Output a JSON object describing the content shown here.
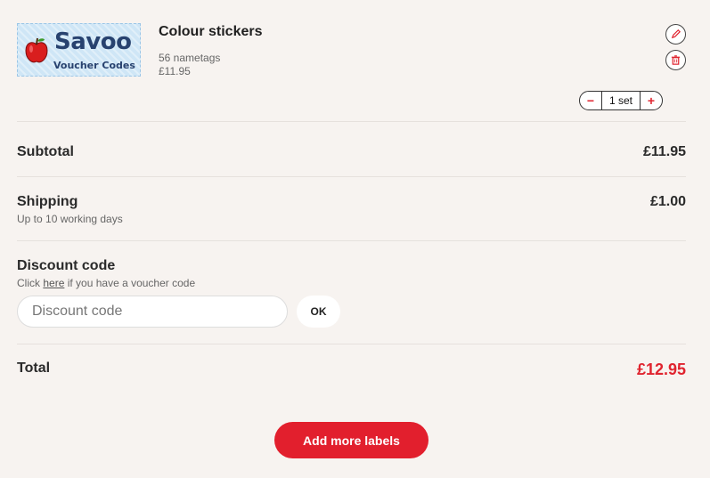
{
  "item": {
    "logo_main": "Savoo",
    "logo_sub": "Voucher Codes",
    "title": "Colour stickers",
    "meta": "56 nametags",
    "price": "£11.95",
    "quantity": "1 set",
    "decrement_symbol": "−",
    "increment_symbol": "+"
  },
  "summary": {
    "subtotal_label": "Subtotal",
    "subtotal_value": "£11.95",
    "shipping_label": "Shipping",
    "shipping_note": "Up to 10 working days",
    "shipping_value": "£1.00",
    "discount_label": "Discount code",
    "discount_note_prefix": "Click ",
    "discount_note_link": "here",
    "discount_note_suffix": " if you have a voucher code",
    "discount_placeholder": "Discount code",
    "ok_label": "OK",
    "total_label": "Total",
    "total_value": "£12.95"
  },
  "actions": {
    "add_more_label": "Add more labels"
  },
  "colors": {
    "accent": "#e21f2d",
    "background": "#f7f3f0"
  },
  "icons": [
    "apple-icon",
    "edit-icon",
    "trash-icon",
    "minus-icon",
    "plus-icon"
  ]
}
